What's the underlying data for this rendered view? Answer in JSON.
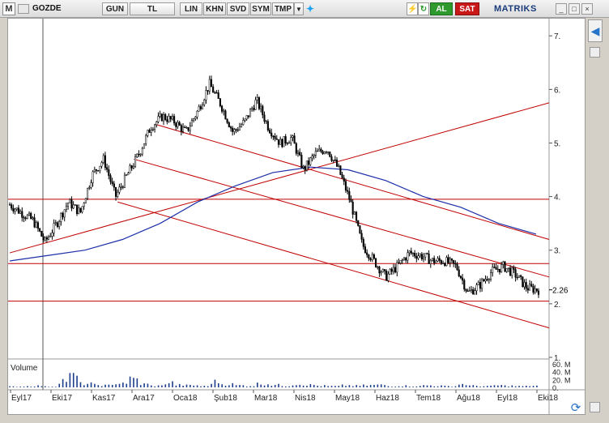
{
  "toolbar": {
    "logo": "M",
    "symbol": "GOZDE",
    "period": "GUN",
    "currency": "TL",
    "buttons": [
      "LIN",
      "KHN",
      "SVD",
      "SYM",
      "TMP"
    ],
    "lightning_label": "⚡",
    "buy_label": "AL",
    "sell_label": "SAT",
    "brand": "MATRIKS"
  },
  "colors": {
    "candle": "#000000",
    "support_line": "#c00000",
    "ma_line": "#1c2fa8",
    "volume": "#1c3c8c",
    "buy": "#2e9a2e",
    "sell": "#c81818",
    "last_price_marker": "#000000"
  },
  "chart_data": {
    "type": "candlestick",
    "symbol": "GOZDE",
    "y_ticks": [
      "7.",
      "6.",
      "5.",
      "4.",
      "3.",
      "2.",
      "1."
    ],
    "y_tick_values": [
      7,
      6,
      5,
      4,
      3,
      2,
      1
    ],
    "y_range": [
      1,
      7.2
    ],
    "last_price": "2.26",
    "x_labels": [
      "Eyl17",
      "Eki17",
      "Kas17",
      "Ara17",
      "Oca18",
      "Şub18",
      "Mar18",
      "Nis18",
      "May18",
      "Haz18",
      "Tem18",
      "Ağu18",
      "Eyl18",
      "Eki18"
    ],
    "volume_label": "Volume",
    "volume_ticks": [
      "60. M",
      "40. M",
      "20. M",
      "0."
    ],
    "volume_tick_values": [
      60,
      40,
      20,
      0
    ],
    "close_series_approx": [
      3.85,
      3.7,
      3.55,
      3.15,
      3.5,
      3.9,
      3.7,
      4.4,
      4.7,
      4.0,
      4.4,
      4.8,
      5.3,
      5.5,
      5.4,
      5.2,
      5.6,
      6.1,
      5.7,
      5.2,
      5.4,
      5.8,
      5.3,
      5.0,
      5.1,
      4.5,
      4.8,
      4.9,
      4.5,
      3.9,
      3.1,
      2.8,
      2.5,
      2.7,
      2.95,
      2.9,
      2.8,
      2.8,
      2.7,
      2.2,
      2.35,
      2.6,
      2.7,
      2.55,
      2.3,
      2.26
    ],
    "moving_average_approx": [
      2.8,
      2.9,
      3.0,
      3.2,
      3.5,
      3.9,
      4.2,
      4.45,
      4.55,
      4.5,
      4.3,
      4.0,
      3.8,
      3.5,
      3.3
    ],
    "horizontal_levels": [
      3.95,
      2.75,
      2.05
    ],
    "volume_values_approx": [
      2,
      3,
      4,
      2,
      18,
      28,
      9,
      6,
      5,
      12,
      20,
      8,
      4,
      12,
      6,
      5,
      3,
      14,
      8,
      5,
      4,
      9,
      6,
      4,
      8,
      6,
      4,
      3,
      5,
      4,
      5,
      6,
      3,
      4,
      3,
      5,
      4,
      3,
      8,
      4,
      3,
      5,
      4,
      3,
      4,
      10
    ]
  }
}
